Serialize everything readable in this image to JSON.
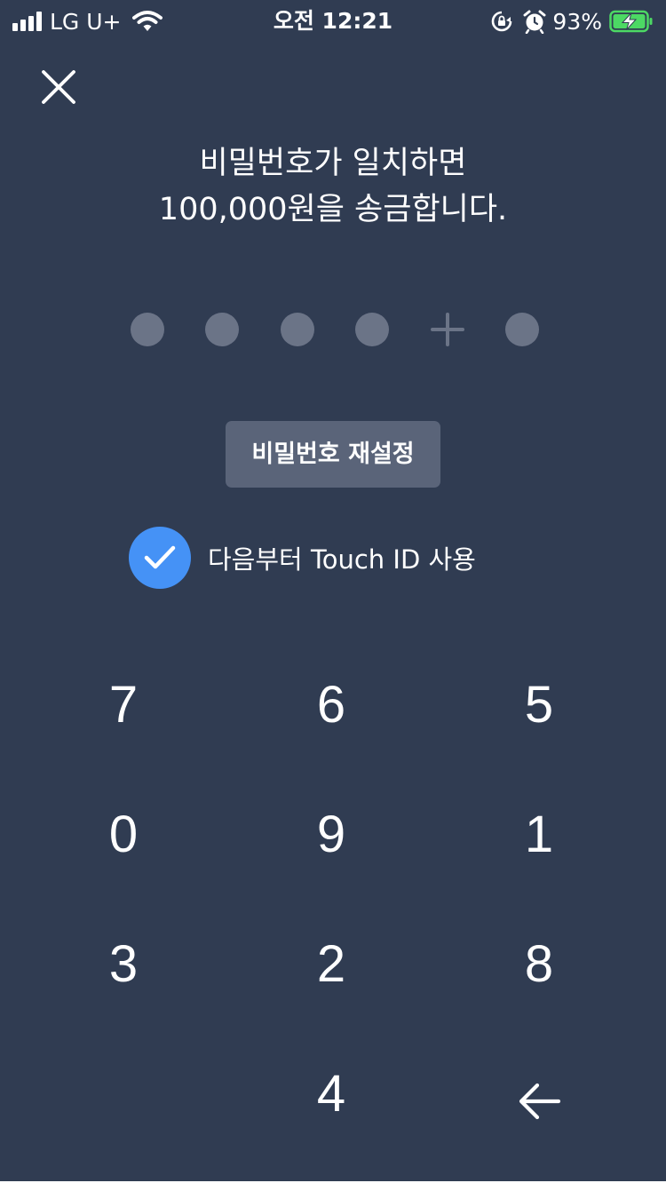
{
  "status_bar": {
    "carrier": "LG U+",
    "time": "오전 12:21",
    "battery_percent": "93%",
    "signal_bars": 4,
    "icons": [
      "signal-icon",
      "wifi-icon",
      "rotation-lock-icon",
      "alarm-icon",
      "battery-charging-icon"
    ]
  },
  "close_icon": "close-icon",
  "title": {
    "line1": "비밀번호가 일치하면",
    "line2": "100,000원을 송금합니다."
  },
  "pin": {
    "length": 6,
    "slots": [
      "dot",
      "dot",
      "dot",
      "dot",
      "plus",
      "dot"
    ]
  },
  "reset_button": {
    "label": "비밀번호 재설정"
  },
  "touch_id": {
    "checked": true,
    "label": "다음부터 Touch ID 사용"
  },
  "keypad": {
    "keys": [
      "7",
      "6",
      "5",
      "0",
      "9",
      "1",
      "3",
      "2",
      "8",
      "",
      "4",
      "←"
    ],
    "backspace_icon": "backspace-arrow-icon"
  },
  "colors": {
    "background": "#303c52",
    "pin_dot": "#6b7487",
    "reset_button_bg": "#5a6479",
    "checkbox_bg": "#4592f6",
    "battery_fill": "#4cd964"
  }
}
